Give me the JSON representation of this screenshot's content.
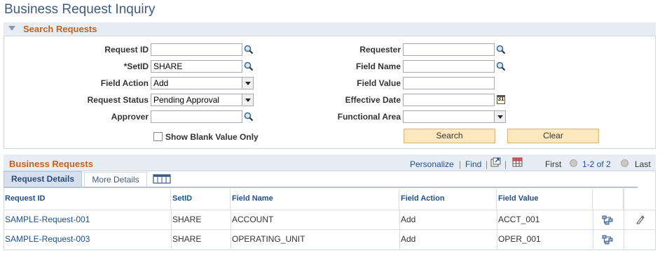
{
  "page": {
    "title": "Business Request Inquiry"
  },
  "search": {
    "section_title": "Search Requests",
    "fields": {
      "request_id": {
        "label": "Request ID",
        "value": ""
      },
      "setid": {
        "label": "*SetID",
        "value": "SHARE"
      },
      "field_action": {
        "label": "Field Action",
        "value": "Add"
      },
      "request_status": {
        "label": "Request Status",
        "value": "Pending Approval"
      },
      "approver": {
        "label": "Approver",
        "value": ""
      },
      "requester": {
        "label": "Requester",
        "value": ""
      },
      "field_name": {
        "label": "Field Name",
        "value": ""
      },
      "field_value": {
        "label": "Field Value",
        "value": ""
      },
      "effective_date": {
        "label": "Effective Date",
        "value": ""
      },
      "functional_area": {
        "label": "Functional Area",
        "value": ""
      }
    },
    "show_blank_label": "Show Blank Value Only",
    "search_button": "Search",
    "clear_button": "Clear"
  },
  "grid": {
    "title": "Business Requests",
    "personalize": "Personalize",
    "separator": "|",
    "find": "Find",
    "first": "First",
    "range": "1-2 of 2",
    "last": "Last",
    "tabs": [
      "Request Details",
      "More Details"
    ],
    "columns": [
      "Request ID",
      "SetID",
      "Field Name",
      "Field Action",
      "Field Value"
    ],
    "rows": [
      {
        "request_id": "SAMPLE-Request-001",
        "setid": "SHARE",
        "field_name": "ACCOUNT",
        "field_action": "Add",
        "field_value": "ACCT_001"
      },
      {
        "request_id": "SAMPLE-Request-003",
        "setid": "SHARE",
        "field_name": "OPERATING_UNIT",
        "field_action": "Add",
        "field_value": "OPER_001"
      }
    ]
  },
  "icons": {
    "lookup": "magnifier-icon",
    "calendar": "calendar-icon",
    "dropdown": "chevron-down-icon",
    "related": "related-content-icon",
    "edit": "pencil-icon",
    "new_window": "new-window-icon",
    "download": "download-grid-icon",
    "columns": "show-all-columns-icon"
  },
  "colors": {
    "accent_orange": "#c0621d",
    "link_blue": "#205090",
    "header_bg": "#e8edf4",
    "button_bg": "#fde7bd"
  }
}
